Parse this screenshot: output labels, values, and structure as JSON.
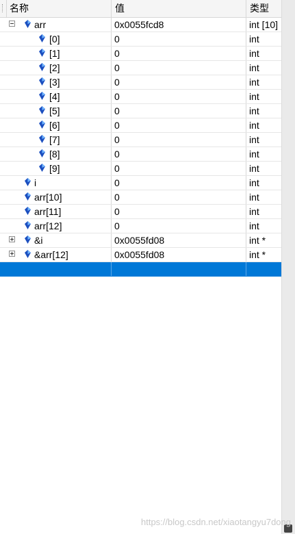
{
  "columns": {
    "name": "名称",
    "value": "值",
    "type": "类型"
  },
  "rows": [
    {
      "name": "arr",
      "value": "0x0055fcd8",
      "type": "int [10]",
      "expander": "minus"
    },
    {
      "name": "[0]",
      "value": "0",
      "type": "int"
    },
    {
      "name": "[1]",
      "value": "0",
      "type": "int"
    },
    {
      "name": "[2]",
      "value": "0",
      "type": "int"
    },
    {
      "name": "[3]",
      "value": "0",
      "type": "int"
    },
    {
      "name": "[4]",
      "value": "0",
      "type": "int"
    },
    {
      "name": "[5]",
      "value": "0",
      "type": "int"
    },
    {
      "name": "[6]",
      "value": "0",
      "type": "int"
    },
    {
      "name": "[7]",
      "value": "0",
      "type": "int"
    },
    {
      "name": "[8]",
      "value": "0",
      "type": "int"
    },
    {
      "name": "[9]",
      "value": "0",
      "type": "int"
    },
    {
      "name": "i",
      "value": "0",
      "type": "int"
    },
    {
      "name": "arr[10]",
      "value": "0",
      "type": "int"
    },
    {
      "name": "arr[11]",
      "value": "0",
      "type": "int"
    },
    {
      "name": "arr[12]",
      "value": "0",
      "type": "int"
    },
    {
      "name": "&i",
      "value": "0x0055fd08",
      "type": "int *",
      "expander": "plus"
    },
    {
      "name": "&arr[12]",
      "value": "0x0055fd08",
      "type": "int *",
      "expander": "plus"
    },
    {
      "name": "",
      "value": "",
      "type": "",
      "selected": true
    }
  ],
  "icons": {
    "variable": "variable-gem-icon",
    "expand": "plus-box-icon",
    "collapse": "minus-box-icon"
  },
  "colors": {
    "selection": "#0078d7",
    "header": "#f5f5f5",
    "gem_light": "#6fb4ff",
    "gem_dark": "#1c4fbf"
  },
  "watermark": "https://blog.csdn.net/xiaotangyu7dong"
}
